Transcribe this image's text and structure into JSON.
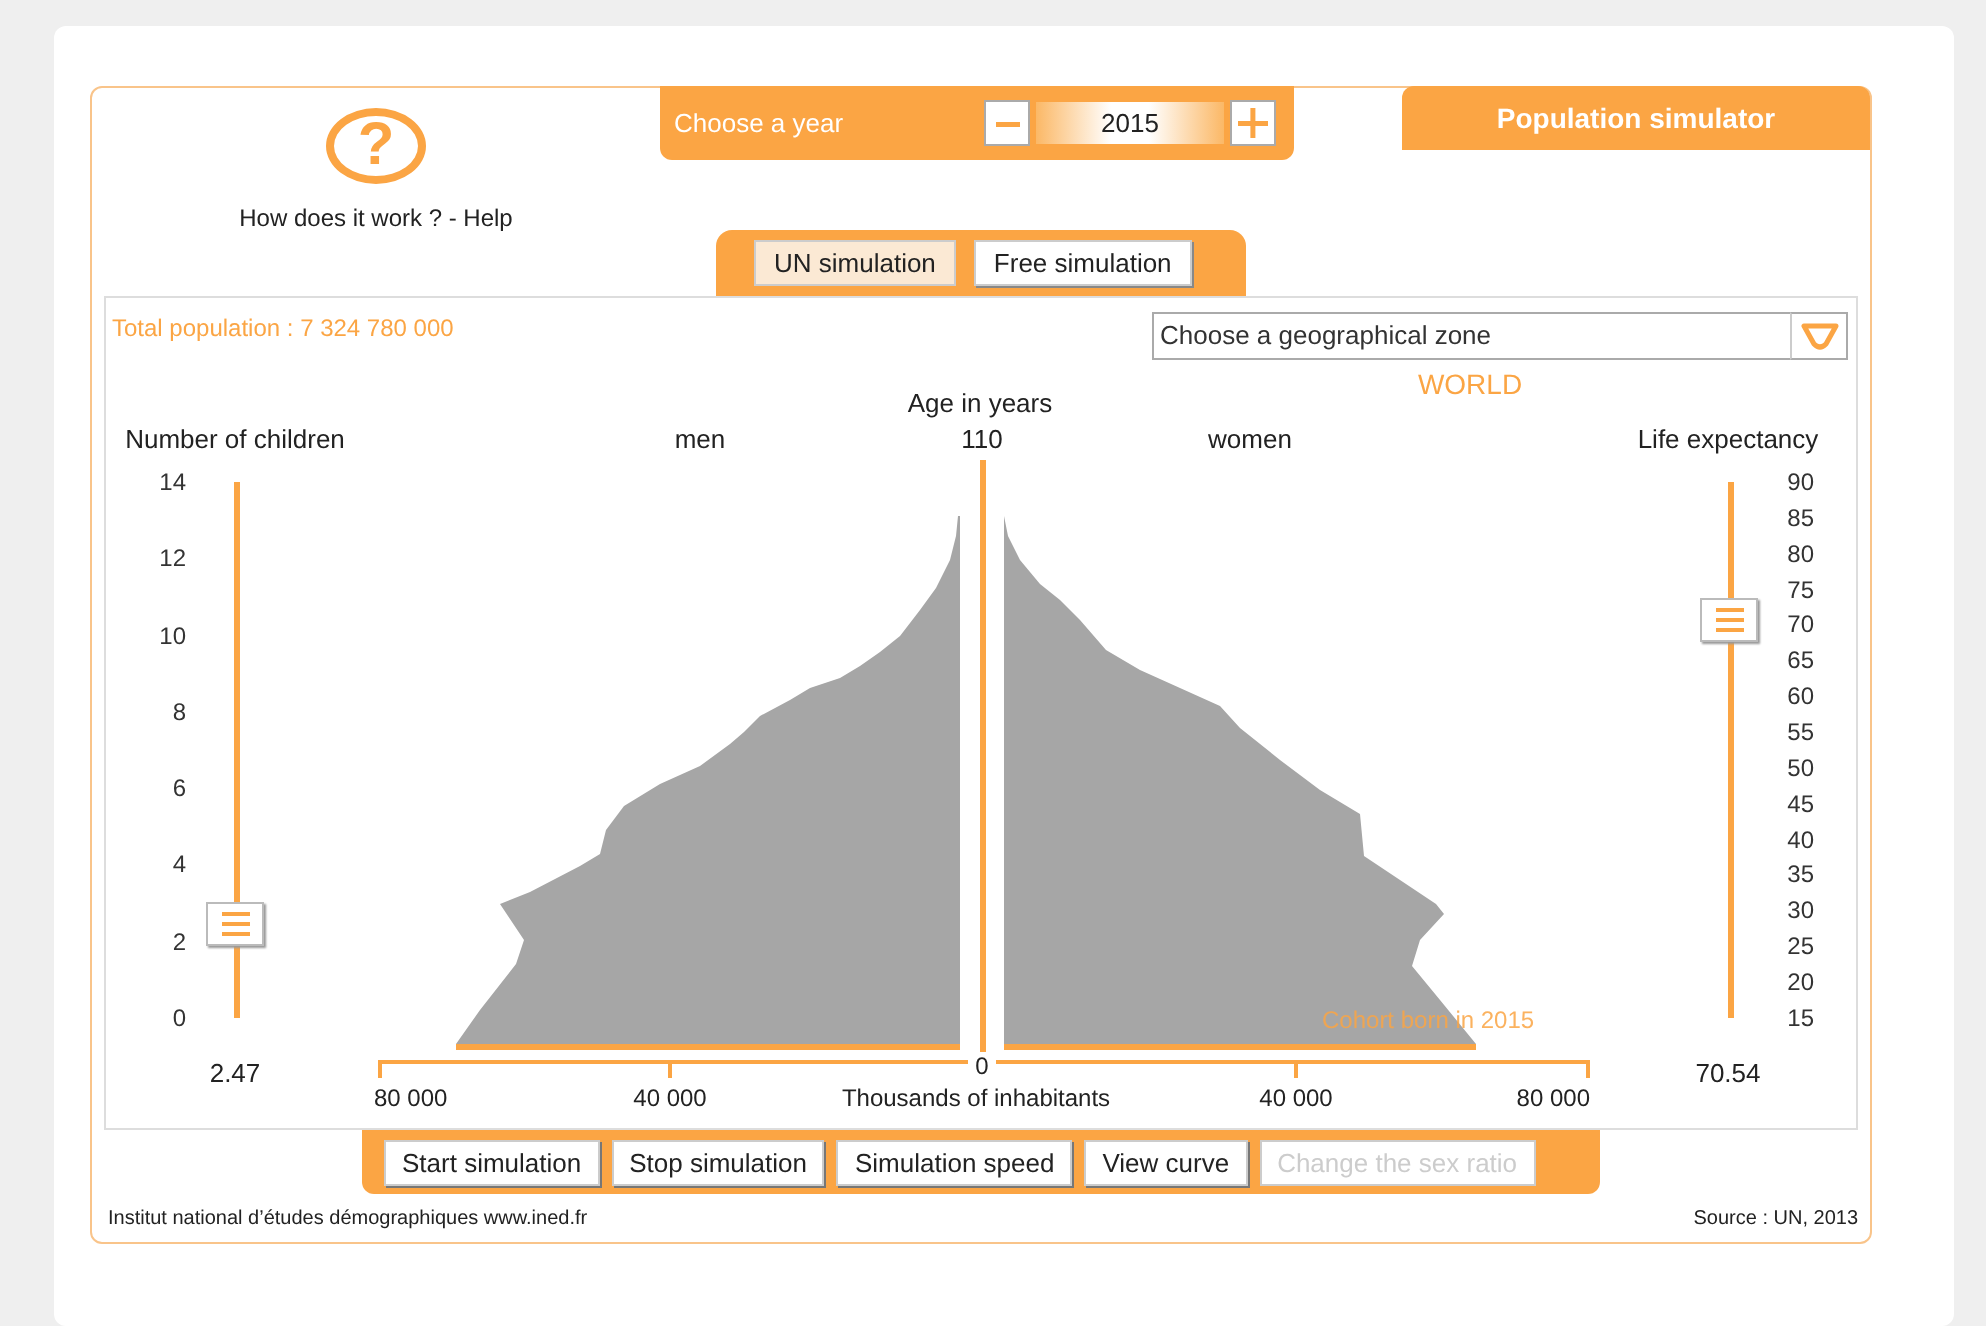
{
  "help": {
    "symbol": "?",
    "label": "How does it work ? - Help"
  },
  "year": {
    "label": "Choose a year",
    "value": "2015"
  },
  "title": "Population simulator",
  "tabs": [
    {
      "label": "UN simulation",
      "selected": true
    },
    {
      "label": "Free simulation",
      "selected": false
    }
  ],
  "total_population": "Total population : 7 324 780 000",
  "zone_select": {
    "placeholder": "Choose a geographical zone"
  },
  "zone": "WORLD",
  "pyramid": {
    "age_axis_title": "Age in years",
    "max_age": "110",
    "left_label": "men",
    "right_label": "women",
    "cohort_label": "Cohort born in 2015",
    "x_axis": {
      "title": "Thousands of inhabitants",
      "zero": "0",
      "ticks_left": [
        "80 000",
        "40 000"
      ],
      "ticks_right": [
        "40 000",
        "80 000"
      ]
    }
  },
  "fertility_slider": {
    "label": "Number of children",
    "ticks": [
      "14",
      "12",
      "10",
      "8",
      "6",
      "4",
      "2",
      "0"
    ],
    "level": 0.176,
    "reading": "2.47"
  },
  "life_slider": {
    "label": "Life expectancy",
    "ticks": [
      "90",
      "85",
      "80",
      "75",
      "70",
      "65",
      "60",
      "55",
      "50",
      "45",
      "40",
      "35",
      "30",
      "25",
      "20",
      "15"
    ],
    "level": 0.741,
    "reading": "70.54"
  },
  "buttons": [
    {
      "label": "Start simulation",
      "disabled": false
    },
    {
      "label": "Stop simulation",
      "disabled": false
    },
    {
      "label": "Simulation speed",
      "disabled": false
    },
    {
      "label": "View curve",
      "disabled": false
    },
    {
      "label": "Change the sex ratio",
      "disabled": true
    }
  ],
  "footer": {
    "credit": "Institut national d’études démographiques www.ined.fr",
    "source": "Source : UN, 2013"
  }
}
